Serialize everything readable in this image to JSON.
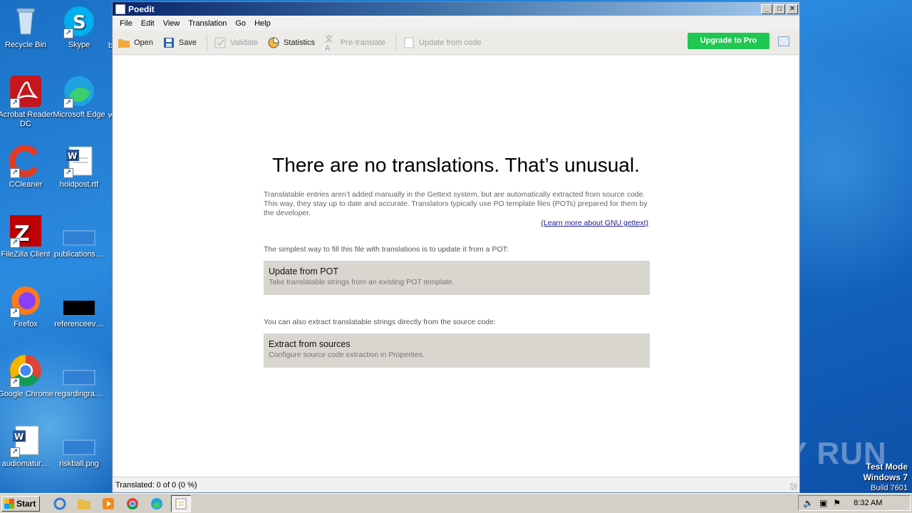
{
  "desktop": {
    "icons": [
      {
        "label": "Recycle Bin",
        "icon": "recycle-bin-icon"
      },
      {
        "label": "Skype",
        "icon": "skype-icon"
      },
      {
        "label": "Acrobat Reader DC",
        "icon": "acrobat-icon"
      },
      {
        "label": "Microsoft Edge",
        "icon": "edge-icon"
      },
      {
        "label": "CCleaner",
        "icon": "ccleaner-icon"
      },
      {
        "label": "holdpost.rtf",
        "icon": "word-document-icon"
      },
      {
        "label": "FileZilla Client",
        "icon": "filezilla-icon"
      },
      {
        "label": "publications....",
        "icon": "blank-file-icon"
      },
      {
        "label": "Firefox",
        "icon": "firefox-icon"
      },
      {
        "label": "referenceev....",
        "icon": "black-file-icon"
      },
      {
        "label": "Google Chrome",
        "icon": "chrome-icon"
      },
      {
        "label": "regardingra....",
        "icon": "blank-file-icon"
      },
      {
        "label": "audiomatur....",
        "icon": "word-document-icon"
      },
      {
        "label": "riskball.png",
        "icon": "blank-file-icon"
      }
    ],
    "edge_glyph_1": "b",
    "edge_glyph_2": "w"
  },
  "window": {
    "title": "Poedit",
    "minimize": "_",
    "maximize": "□",
    "close": "✕"
  },
  "menu": [
    "File",
    "Edit",
    "View",
    "Translation",
    "Go",
    "Help"
  ],
  "toolbar": {
    "open": "Open",
    "save": "Save",
    "validate": "Validate",
    "statistics": "Statistics",
    "pretranslate": "Pre-translate",
    "update_from_code": "Update from code",
    "upgrade": "Upgrade to Pro"
  },
  "main": {
    "heading": "There are no translations. That’s unusual.",
    "paragraph": "Translatable entries aren’t added manually in the Gettext system, but are automatically extracted from source code. This way, they stay up to date and accurate. Translators typically use PO template files (POTs) prepared for them by the developer.",
    "learn_link": "(Learn more about GNU gettext)",
    "lead1": "The simplest way to fill this file with translations is to update it from a POT:",
    "action1_title": "Update from POT",
    "action1_sub": "Take translatable strings from an existing POT template.",
    "lead2": "You can also extract translatable strings directly from the source code:",
    "action2_title": "Extract from sources",
    "action2_sub": "Configure source code extraction in Properties."
  },
  "status": {
    "text": "Translated: 0 of 0 (0 %)"
  },
  "watermark": "ANY RUN",
  "testmode": {
    "line1": "Test Mode",
    "line2": "Windows 7",
    "line3": "Build 7601"
  },
  "taskbar": {
    "start": "Start",
    "clock": "8:32 AM"
  }
}
